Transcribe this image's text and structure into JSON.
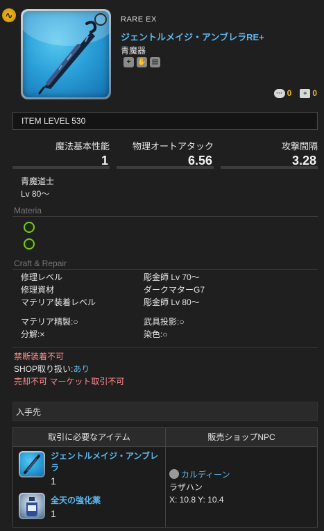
{
  "item": {
    "rarity": "RARE EX",
    "name": "ジェントルメイジ・アンブレラRE+",
    "type": "青魔器",
    "comments_count": "0",
    "lists_count": "0",
    "item_level": "ITEM LEVEL 530"
  },
  "stats": [
    {
      "label": "魔法基本性能",
      "value": "1"
    },
    {
      "label": "物理オートアタック",
      "value": "6.56"
    },
    {
      "label": "攻撃間隔",
      "value": "3.28"
    }
  ],
  "requirements": {
    "job": "青魔道士",
    "level": "Lv 80〜"
  },
  "materia": {
    "title": "Materia",
    "slots": 2
  },
  "craft": {
    "title": "Craft & Repair",
    "rows": [
      {
        "label": "修理レベル",
        "value": "彫金師 Lv 70〜"
      },
      {
        "label": "修理資材",
        "value": "ダークマターG7"
      },
      {
        "label": "マテリア装着レベル",
        "value": "彫金師 Lv 80〜"
      }
    ],
    "flags_left": [
      "マテリア精製:○",
      "分解:×"
    ],
    "flags_right": [
      "武具投影:○",
      "染色:○"
    ]
  },
  "restrictions": {
    "line1": "禁断装着不可",
    "shop_label": "SHOP取り扱い:",
    "shop_value": "あり",
    "line3": "売却不可 マーケット取引不可"
  },
  "acquisition": {
    "title": "入手先",
    "col1_header": "取引に必要なアイテム",
    "col2_header": "販売ショップNPC",
    "items": [
      {
        "name_line1": "ジェントルメイジ・アンブレ",
        "name_line2": "ラ",
        "qty": "1",
        "icon": "umbrella-icon"
      },
      {
        "name_line1": "全天の強化薬",
        "qty": "1",
        "icon": "potion-icon"
      }
    ],
    "npc": {
      "name": "カルディーン",
      "location": "ラザハン",
      "coords": "X: 10.8 Y: 10.4"
    }
  },
  "colors": {
    "link": "#5cb8f0",
    "warning": "#ff8a8a",
    "accent": "#f0b820",
    "materia": "#7bc820"
  }
}
